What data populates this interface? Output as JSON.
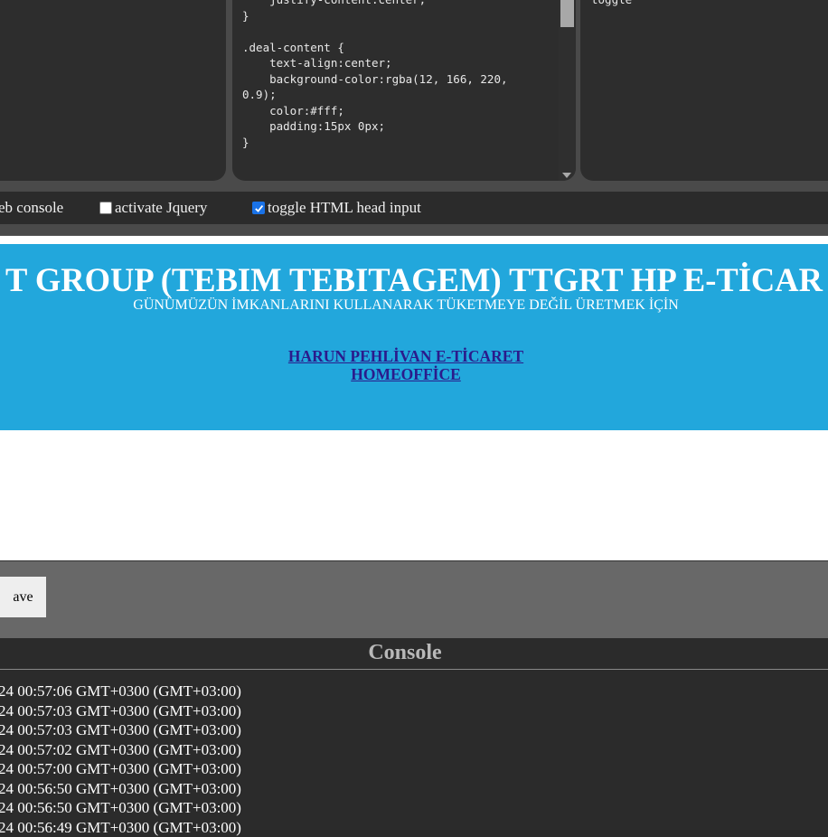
{
  "editors": {
    "css_code": "    justify-content:center;\n}\n\n.deal-content {\n    text-align:center;\n    background-color:rgba(12, 166, 220,\n0.9);\n    color:#fff;\n    padding:15px 0px;\n}",
    "js_code": "toggle"
  },
  "options": {
    "web_console_label": "eb console",
    "jquery_label": "activate Jquery",
    "jquery_checked": false,
    "head_input_label": "toggle HTML head input",
    "head_input_checked": true
  },
  "preview": {
    "title": "T GROUP (TEBIM TEBITAGEM) TTGRT HP E-TİCAR",
    "subtitle": "GÜNÜMÜZÜN İMKANLARINI KULLANARAK TÜKETMEYE DEĞİL ÜRETMEK İÇİN",
    "link_line1": "HARUN PEHLİVAN E-TİCARET",
    "link_line2": "HOMEOFFİCE",
    "banner_color": "#22a7dc"
  },
  "save": {
    "label": "ave"
  },
  "console": {
    "title": "Console",
    "lines": [
      "24 00:57:06 GMT+0300 (GMT+03:00)",
      "24 00:57:03 GMT+0300 (GMT+03:00)",
      "24 00:57:03 GMT+0300 (GMT+03:00)",
      "24 00:57:02 GMT+0300 (GMT+03:00)",
      "24 00:57:00 GMT+0300 (GMT+03:00)",
      "24 00:56:50 GMT+0300 (GMT+03:00)",
      "24 00:56:50 GMT+0300 (GMT+03:00)",
      "24 00:56:49 GMT+0300 (GMT+03:00)"
    ]
  }
}
